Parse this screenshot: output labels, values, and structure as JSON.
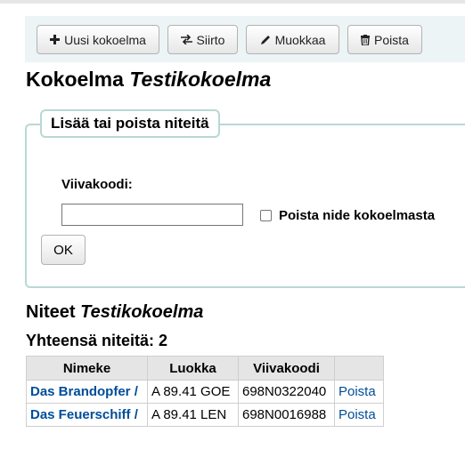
{
  "toolbar": {
    "new_collection": "Uusi kokoelma",
    "transfer": "Siirto",
    "edit": "Muokkaa",
    "delete": "Poista"
  },
  "page": {
    "title_prefix": "Kokoelma",
    "title_name": "Testikokoelma"
  },
  "add_remove": {
    "legend": "Lisää tai poista niteitä",
    "barcode_label": "Viivakoodi:",
    "barcode_value": "",
    "remove_checkbox_label": "Poista nide kokoelmasta",
    "remove_checked": false,
    "ok_label": "OK"
  },
  "items": {
    "heading_prefix": "Niteet",
    "heading_name": "Testikokoelma",
    "total_label": "Yhteensä niteitä: 2",
    "columns": [
      "Nimeke",
      "Luokka",
      "Viivakoodi",
      ""
    ],
    "rows": [
      {
        "title": "Das Brandopfer /",
        "callnumber": "A 89.41 GOE",
        "barcode": "698N0322040",
        "action": "Poista"
      },
      {
        "title": "Das Feuerschiff /",
        "callnumber": "A 89.41 LEN",
        "barcode": "698N0016988",
        "action": "Poista"
      }
    ]
  },
  "colors": {
    "toolbar_bg": "#edf4f6",
    "fieldset_border": "#b8d8d4",
    "link": "#004d99",
    "table_header_bg": "#e5e5e5"
  }
}
